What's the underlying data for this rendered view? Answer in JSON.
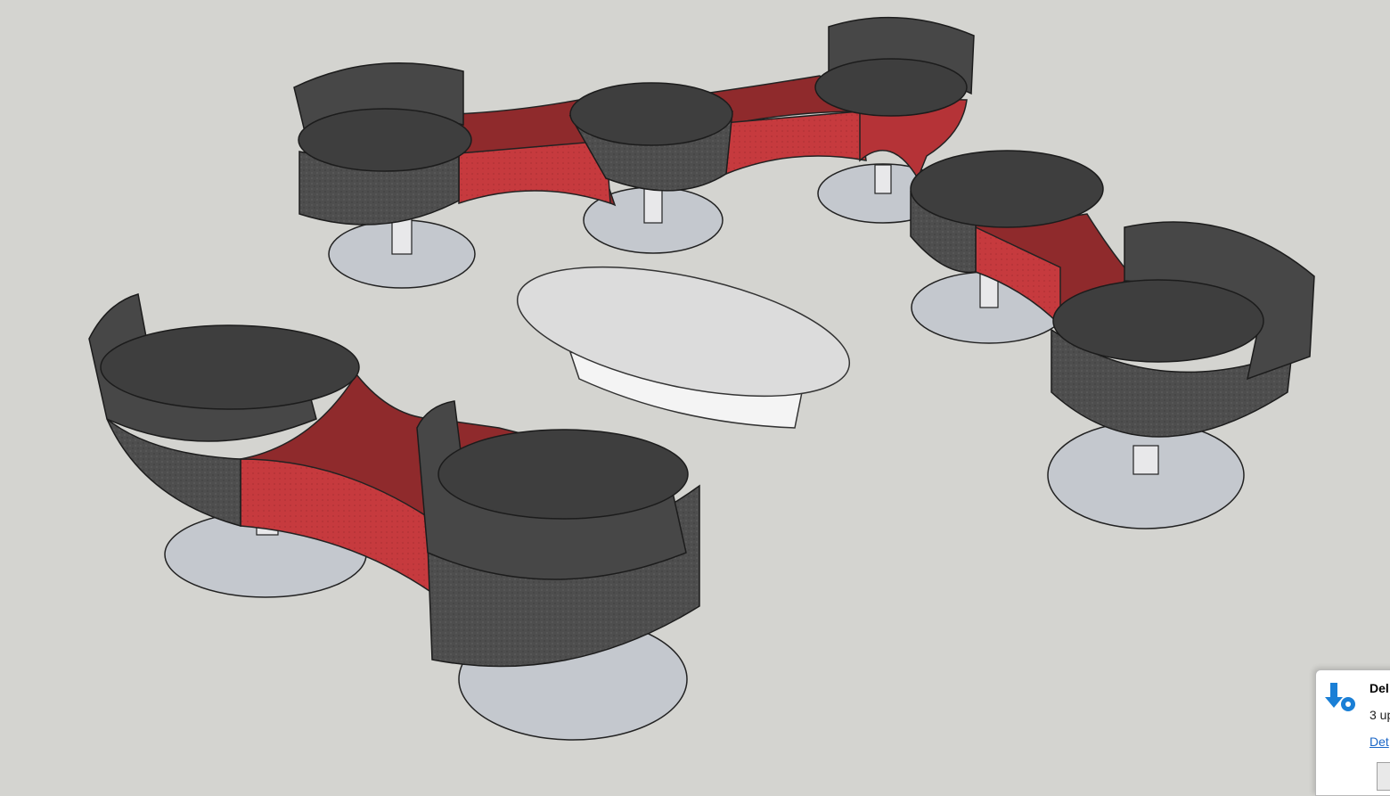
{
  "app": {
    "viewport_background": "#d4d4d0"
  },
  "scene": {
    "description_colors": {
      "upholstery_dark": "#505050",
      "seat_top": "#454545",
      "connector_red": "#c23a3d",
      "connector_red_dark": "#8f2a2c",
      "base_disk": "#c2c6cc",
      "table_top": "#e2e2e2"
    }
  },
  "notification": {
    "icon": "update-gear-icon",
    "title": "Del",
    "body": "3 up",
    "link": "Det",
    "accent": "#1a66c7"
  }
}
